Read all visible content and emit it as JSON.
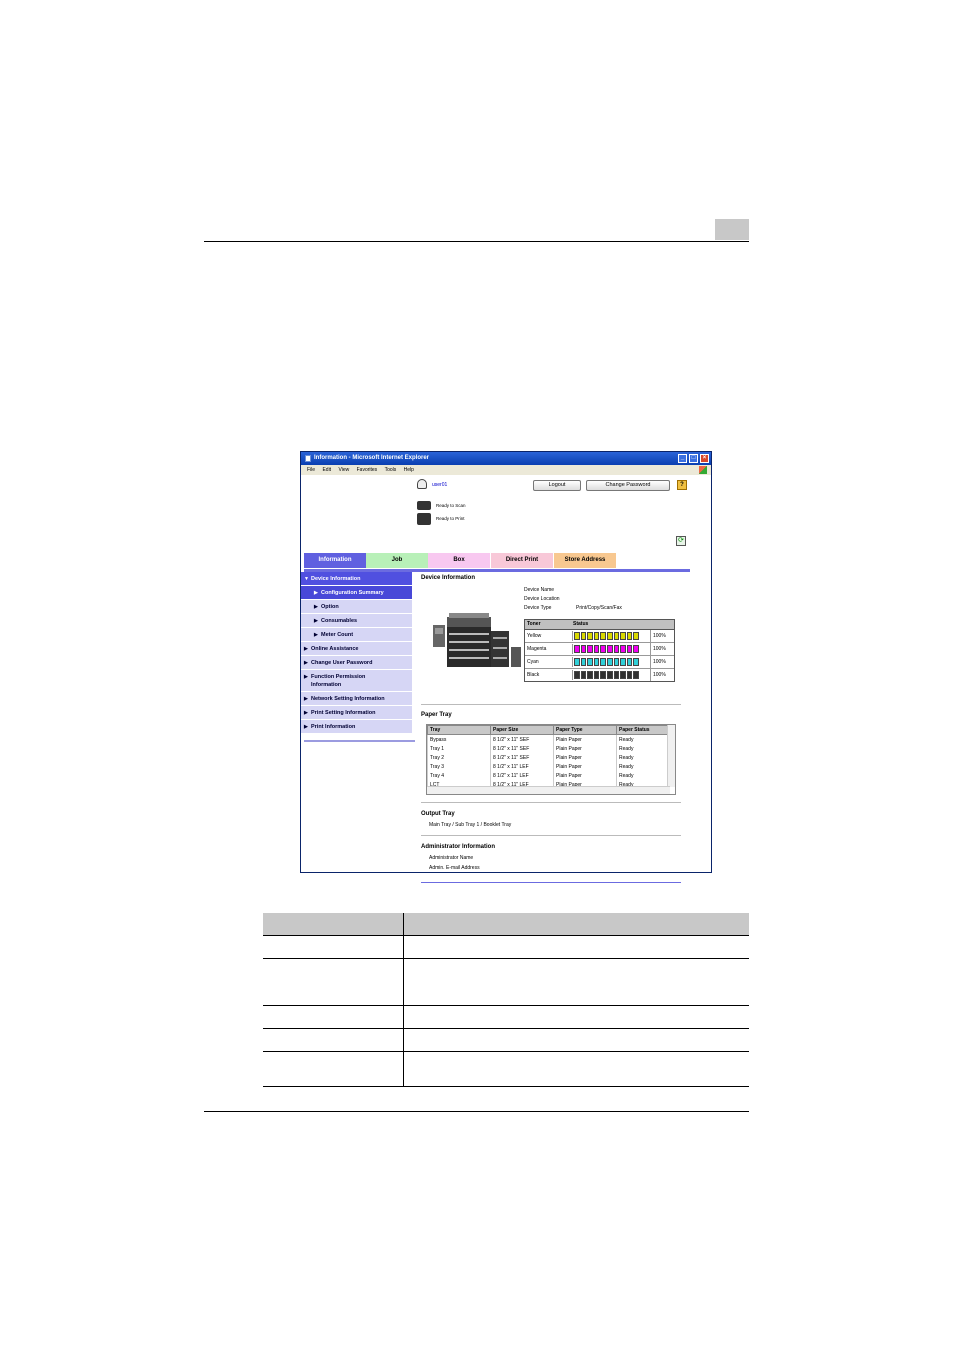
{
  "window": {
    "title": "Information - Microsoft Internet Explorer",
    "menu": [
      "File",
      "Edit",
      "View",
      "Favorites",
      "Tools",
      "Help"
    ],
    "controls": {
      "minimize": "_",
      "maximize": "□",
      "close": "×"
    }
  },
  "header": {
    "user_name": "user01",
    "logout_label": "Logout",
    "change_password_label": "Change Password",
    "help_label": "?",
    "scan_status": "Ready to Scan",
    "print_status": "Ready to Print",
    "refresh_icon": "refresh-icon"
  },
  "tabs": [
    {
      "label": "Information",
      "color": "#6060e0"
    },
    {
      "label": "Job",
      "color": "#b8f0b8"
    },
    {
      "label": "Box",
      "color": "#f8c8f0"
    },
    {
      "label": "Direct Print",
      "color": "#f8c8d8"
    },
    {
      "label": "Store Address",
      "color": "#f8c890"
    }
  ],
  "sidebar": {
    "items": [
      {
        "label": "Device Information",
        "arrow": "▼"
      },
      {
        "label": "Configuration Summary",
        "arrow": "▶"
      },
      {
        "label": "Option",
        "arrow": "▶"
      },
      {
        "label": "Consumables",
        "arrow": "▶"
      },
      {
        "label": "Meter Count",
        "arrow": "▶"
      },
      {
        "label": "Online Assistance",
        "arrow": "▶"
      },
      {
        "label": "Change User Password",
        "arrow": "▶"
      },
      {
        "label": "Function Permission Information",
        "arrow": "▶"
      },
      {
        "label": "Network Setting Information",
        "arrow": "▶"
      },
      {
        "label": "Print Setting Information",
        "arrow": "▶"
      },
      {
        "label": "Print Information",
        "arrow": "▶"
      }
    ]
  },
  "device_info": {
    "heading": "Device Information",
    "name_label": "Device Name",
    "location_label": "Device Location",
    "type_label": "Device Type",
    "type_value": "Print/Copy/Scan/Fax"
  },
  "toner": {
    "headers": [
      "Toner",
      "Status"
    ],
    "rows": [
      {
        "name": "Yellow",
        "percent": "100%",
        "color": "#d8d800",
        "level": 1.0
      },
      {
        "name": "Magenta",
        "percent": "100%",
        "color": "#f000f0",
        "level": 1.0
      },
      {
        "name": "Cyan",
        "percent": "100%",
        "color": "#30d0d8",
        "level": 1.0
      },
      {
        "name": "Black",
        "percent": "100%",
        "color": "#303030",
        "level": 1.0
      }
    ]
  },
  "paper_tray": {
    "heading": "Paper Tray",
    "headers": [
      "Tray",
      "Paper Size",
      "Paper Type",
      "Paper Status"
    ],
    "rows": [
      [
        "Bypass",
        "8 1/2\" x 11\" SEF",
        "Plain Paper",
        "Ready"
      ],
      [
        "Tray 1",
        "8 1/2\" x 11\" SEF",
        "Plain Paper",
        "Ready"
      ],
      [
        "Tray 2",
        "8 1/2\" x 11\" SEF",
        "Plain Paper",
        "Ready"
      ],
      [
        "Tray 3",
        "8 1/2\" x 11\" LEF",
        "Plain Paper",
        "Ready"
      ],
      [
        "Tray 4",
        "8 1/2\" x 11\" LEF",
        "Plain Paper",
        "Ready"
      ],
      [
        "LCT",
        "8 1/2\" x 11\" LEF",
        "Plain Paper",
        "Ready"
      ]
    ]
  },
  "output_tray": {
    "heading": "Output Tray",
    "value": "Main Tray / Sub Tray 1 / Booklet Tray"
  },
  "admin_info": {
    "heading": "Administrator Information",
    "name_label": "Administrator Name",
    "email_label": "Admin. E-mail Address"
  }
}
